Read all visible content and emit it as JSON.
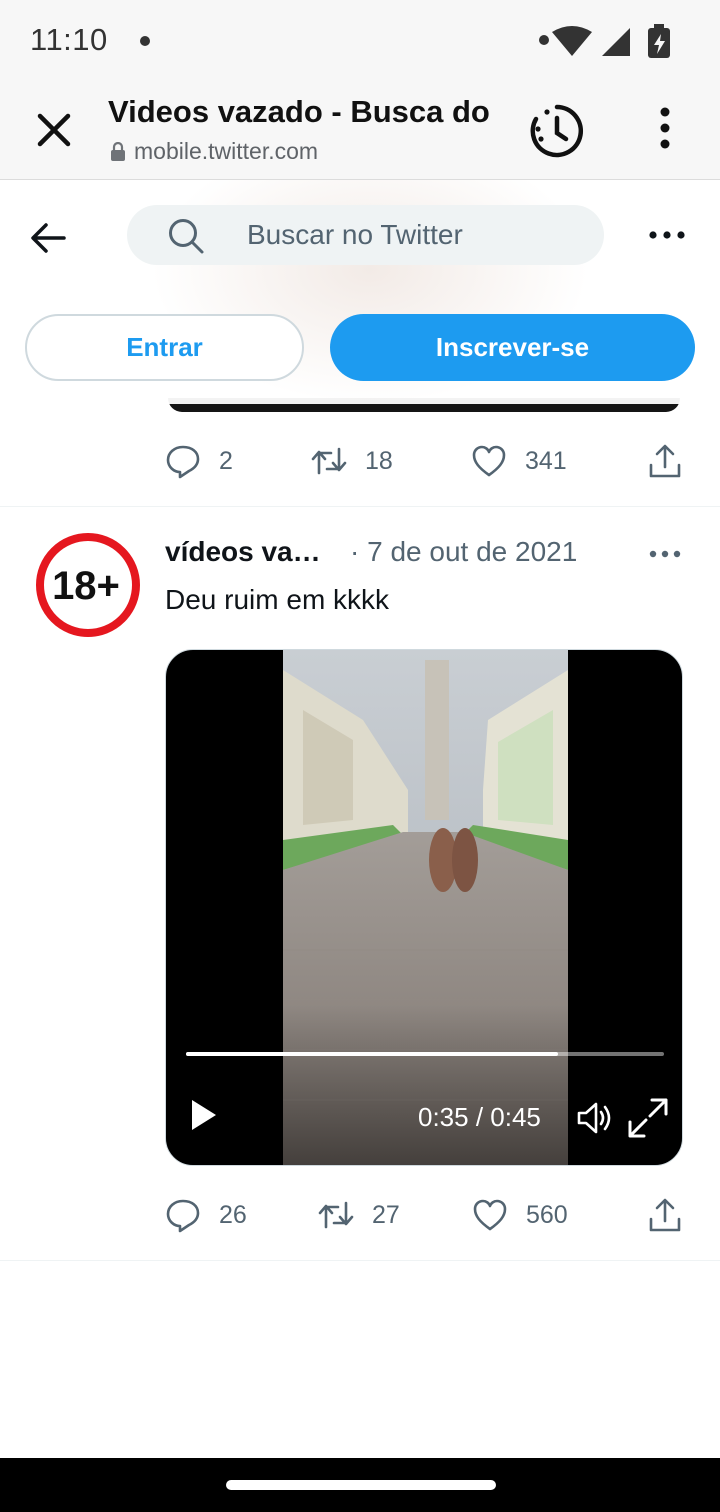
{
  "status_bar": {
    "time": "11:10"
  },
  "browser": {
    "title": "Videos vazado - Busca do",
    "url": "mobile.twitter.com"
  },
  "header": {
    "search_placeholder": "Buscar no Twitter",
    "login_label": "Entrar",
    "signup_label": "Inscrever-se",
    "brand_color": "#1d9bf0"
  },
  "previous_tweet": {
    "replies": "2",
    "retweets": "18",
    "likes": "341"
  },
  "tweet": {
    "avatar_text": "18+",
    "name": "vídeos va…",
    "date": "· 7 de out de 2021",
    "text": "Deu ruim em kkkk",
    "video": {
      "time_display": "0:35 / 0:45",
      "progress": 0.778
    },
    "replies": "26",
    "retweets": "27",
    "likes": "560"
  },
  "icons": [
    "close-icon",
    "lock-icon",
    "history-icon",
    "menu-icon",
    "back-arrow-icon",
    "search-icon",
    "more-icon",
    "reply-icon",
    "retweet-icon",
    "like-icon",
    "share-icon",
    "play-icon",
    "volume-icon",
    "fullscreen-icon"
  ]
}
